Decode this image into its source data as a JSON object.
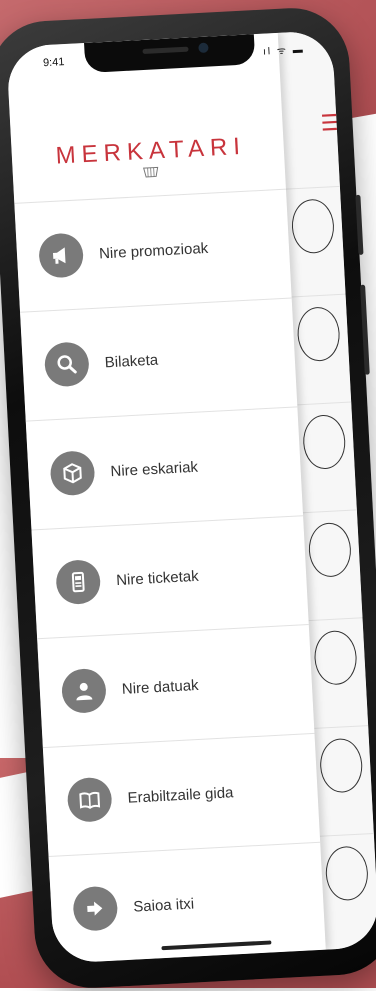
{
  "status": {
    "time": "9:41",
    "icons": "ıl ᯤ ▬"
  },
  "header": {
    "logo": "MERKATARI",
    "menu_icon": "hamburger-icon"
  },
  "brand": {
    "accent": "#c8343c",
    "icon_bg": "#7a7a7a"
  },
  "menu": {
    "items": [
      {
        "label": "Nire promozioak",
        "icon": "megaphone-icon"
      },
      {
        "label": "Bilaketa",
        "icon": "search-icon"
      },
      {
        "label": "Nire eskariak",
        "icon": "package-icon"
      },
      {
        "label": "Nire ticketak",
        "icon": "receipt-printer-icon"
      },
      {
        "label": "Nire datuak",
        "icon": "user-icon"
      },
      {
        "label": "Erabiltzaile gida",
        "icon": "book-icon"
      },
      {
        "label": "Saioa itxi",
        "icon": "logout-icon"
      }
    ]
  }
}
